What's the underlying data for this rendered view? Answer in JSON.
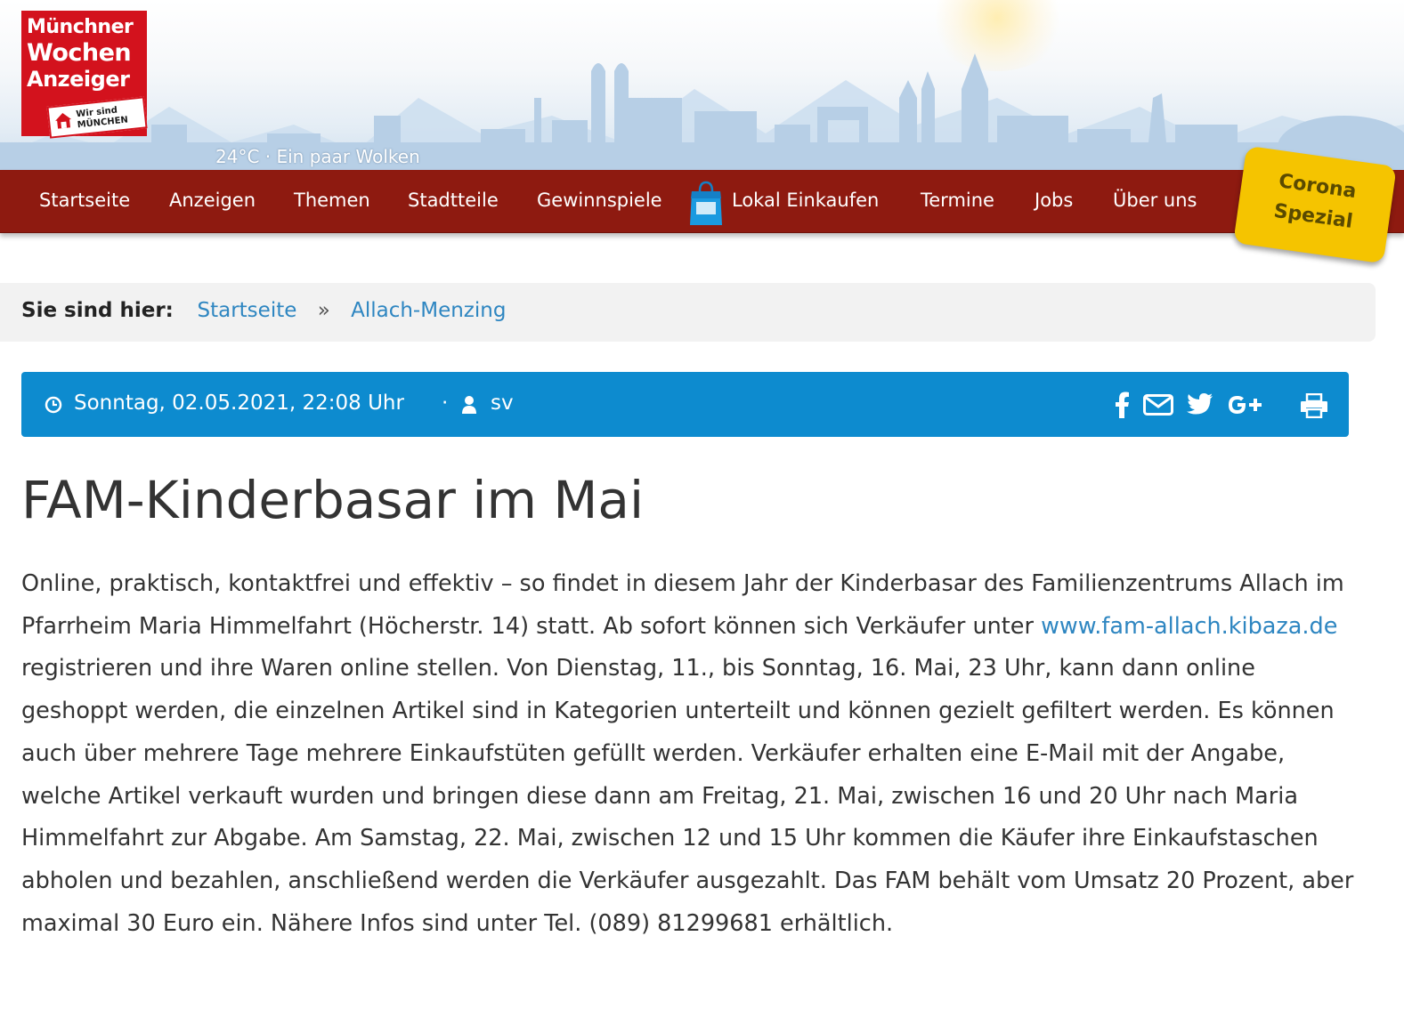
{
  "logo": {
    "line1": "Münchner",
    "line2": "Wochen",
    "line3": "Anzeiger",
    "badge_line1": "Wir sind",
    "badge_line2": "MÜNCHEN"
  },
  "weather": "24°C · Ein paar Wolken",
  "nav": {
    "items": [
      "Startseite",
      "Anzeigen",
      "Themen",
      "Stadtteile",
      "Gewinnspiele",
      "Lokal Einkaufen",
      "Termine",
      "Jobs",
      "Über uns"
    ],
    "corona_line1": "Corona",
    "corona_line2": "Spezial"
  },
  "breadcrumb": {
    "label": "Sie sind hier:",
    "home": "Startseite",
    "separator": "»",
    "current": "Allach-Menzing"
  },
  "meta": {
    "date": "Sonntag, 02.05.2021, 22:08 Uhr",
    "separator": "·",
    "author": "sv",
    "share_icons": [
      "facebook-icon",
      "mail-icon",
      "twitter-icon",
      "google-plus-icon",
      "print-icon"
    ]
  },
  "article": {
    "title": "FAM-Kinderbasar im Mai",
    "text_before_link": "Online, praktisch, kontaktfrei und effektiv – so findet in diesem Jahr der Kinderbasar des Familienzentrums Allach im Pfarrheim Maria Himmelfahrt (Höcherstr. 14) statt. Ab sofort können sich Verkäufer unter ",
    "link_text": "www.fam-allach.kibaza.de",
    "text_after_link": " registrieren und ihre Waren online stellen. Von Dienstag, 11., bis Sonntag, 16. Mai, 23 Uhr, kann dann online geshoppt werden, die einzelnen Artikel sind in Kategorien unterteilt und können gezielt gefiltert werden. Es können auch über mehrere Tage mehrere Einkaufstüten gefüllt werden. Verkäufer erhalten eine E-Mail mit der Angabe, welche Artikel verkauft wurden und bringen diese dann am Freitag, 21. Mai, zwischen 16 und 20 Uhr nach Maria Himmelfahrt zur Abgabe. Am Samstag, 22. Mai, zwischen 12 und 15 Uhr kommen die Käufer ihre Einkaufstaschen abholen und bezahlen, anschließend werden die Verkäufer ausgezahlt. Das FAM behält vom Umsatz 20 Prozent, aber maximal 30 Euro ein. Nähere Infos sind unter Tel. (089) 81299681 erhältlich."
  },
  "colors": {
    "nav_bg": "#8e1a10",
    "meta_bg": "#0d8bcf",
    "link": "#2e86c1",
    "logo_red": "#d3121d",
    "corona_yellow": "#f5c400"
  }
}
